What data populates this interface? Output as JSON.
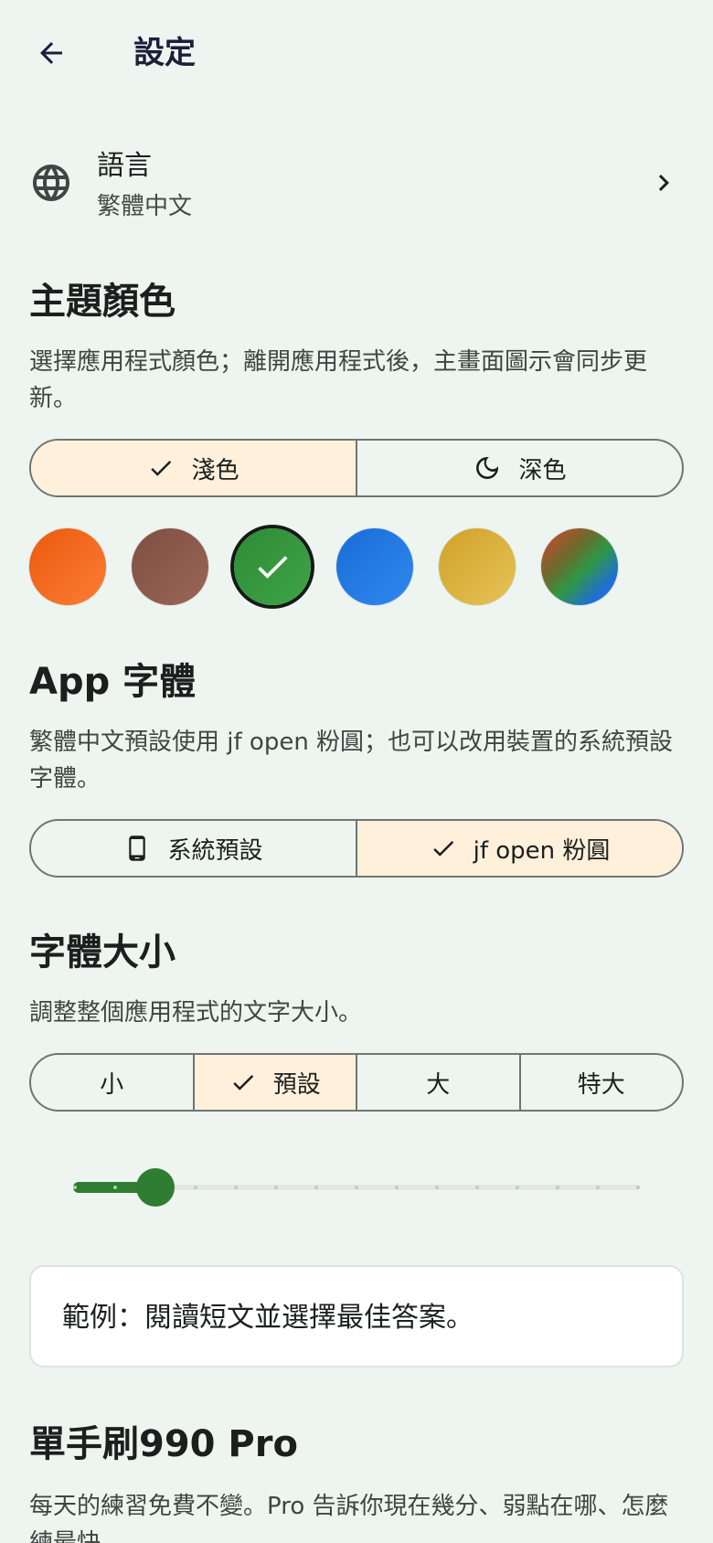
{
  "header": {
    "title": "設定",
    "back_icon": "arrow-left-icon"
  },
  "language": {
    "icon": "globe-icon",
    "title": "語言",
    "value": "繁體中文",
    "chevron": "chevron-right-icon"
  },
  "theme": {
    "title": "主題顏色",
    "description": "選擇應用程式顏色；離開應用程式後，主畫面圖示會同步更新。",
    "modes": [
      {
        "label": "淺色",
        "icon": "check-icon",
        "selected": true
      },
      {
        "label": "深色",
        "icon": "moon-icon",
        "selected": false
      }
    ],
    "swatches": [
      {
        "name": "orange",
        "color": "#f4691f",
        "selected": false
      },
      {
        "name": "brown",
        "color": "#8d5a4c",
        "selected": false
      },
      {
        "name": "green",
        "color": "#35963c",
        "selected": true
      },
      {
        "name": "blue",
        "color": "#1f78e4",
        "selected": false
      },
      {
        "name": "gold",
        "color": "#d9b23c",
        "selected": false
      },
      {
        "name": "multicolor",
        "color": "gradient",
        "selected": false
      }
    ]
  },
  "app_font": {
    "title": "App 字體",
    "description": "繁體中文預設使用 jf open 粉圓；也可以改用裝置的系統預設字體。",
    "options": [
      {
        "label": "系統預設",
        "icon": "phone-icon",
        "selected": false
      },
      {
        "label": "jf open 粉圓",
        "icon": "check-icon",
        "selected": true
      }
    ]
  },
  "font_size": {
    "title": "字體大小",
    "description": "調整整個應用程式的文字大小。",
    "options": [
      {
        "label": "小",
        "selected": false
      },
      {
        "label": "預設",
        "selected": true
      },
      {
        "label": "大",
        "selected": false
      },
      {
        "label": "特大",
        "selected": false
      }
    ],
    "slider": {
      "steps": 15,
      "value_index": 2
    }
  },
  "sample": {
    "text": "範例：閱讀短文並選擇最佳答案。"
  },
  "pro": {
    "title": "單手刷990 Pro",
    "description": "每天的練習免費不變。Pro 告訴你現在幾分、弱點在哪、怎麼練最快。"
  },
  "colors": {
    "accent": "#2e7d32",
    "selected_bg": "#fff0dc",
    "background": "#eef5f1"
  }
}
